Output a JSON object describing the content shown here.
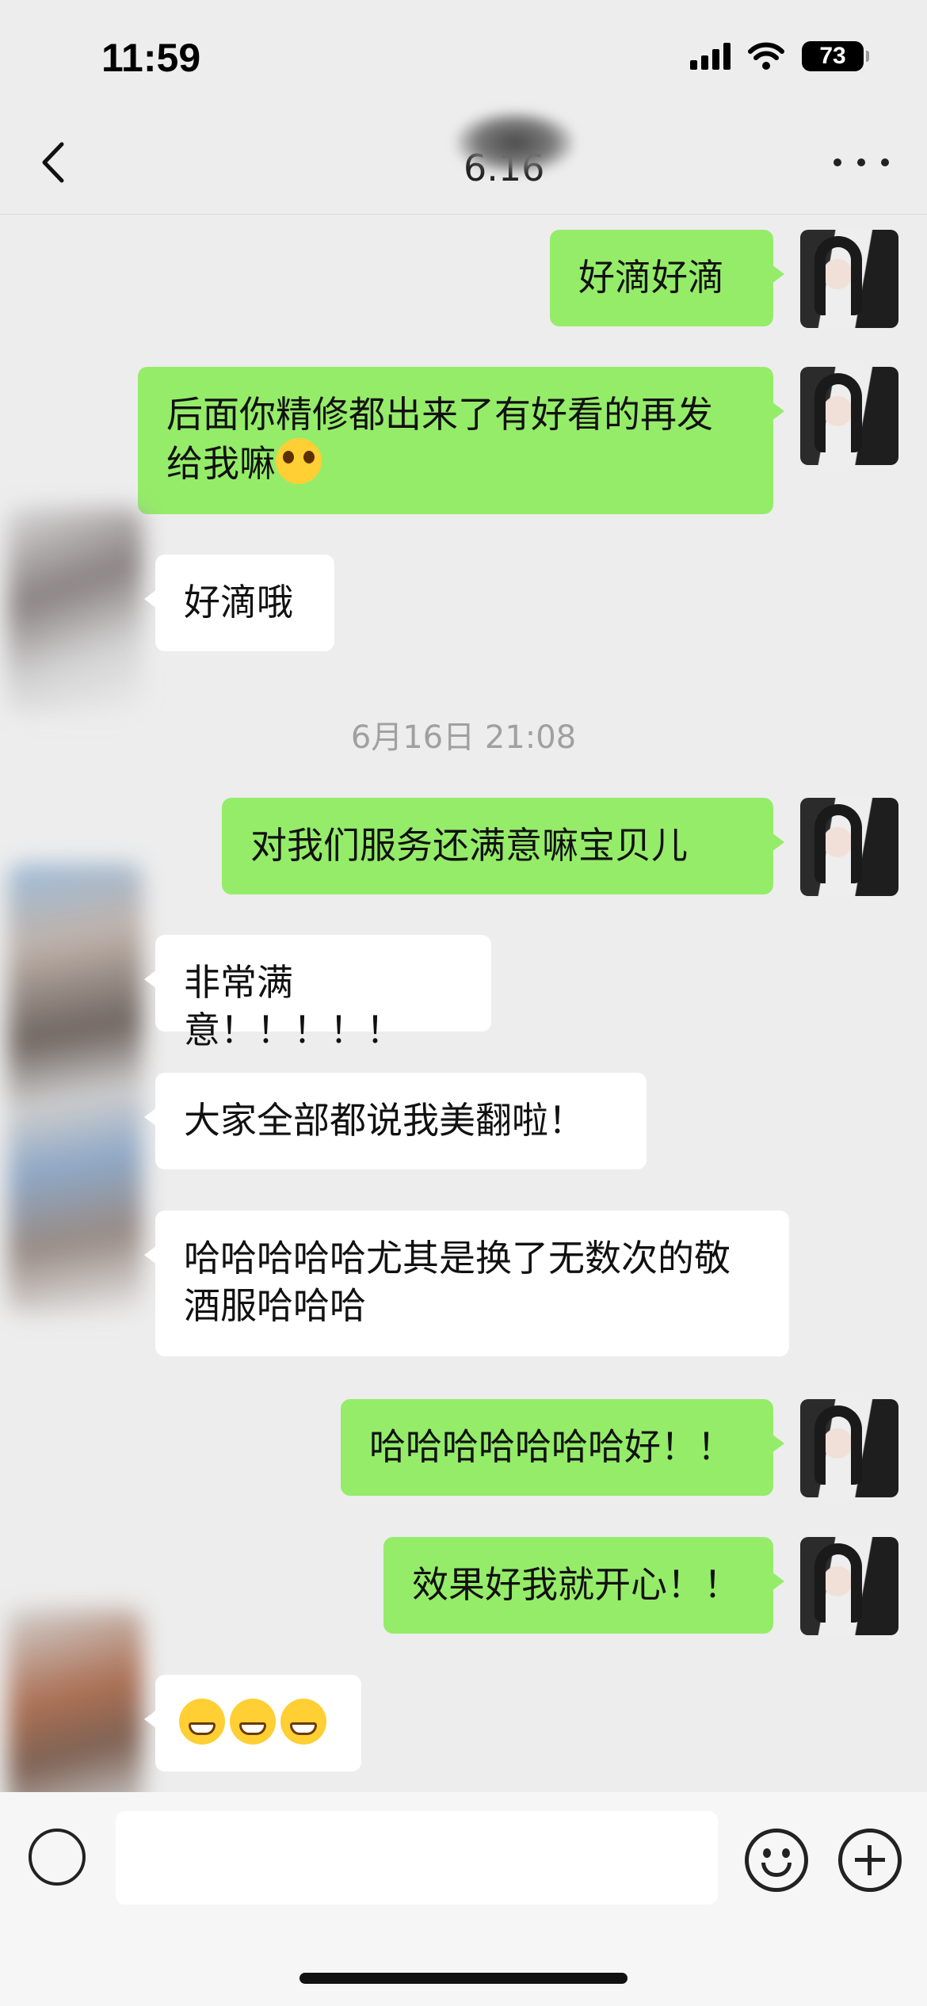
{
  "status_bar": {
    "time": "11:59",
    "battery": "73"
  },
  "header": {
    "title": "6.16"
  },
  "messages": [
    {
      "from": "me",
      "text": "好滴好滴"
    },
    {
      "from": "me",
      "text": "后面你精修都出来了有好看的再发给我嘛",
      "emoji": "pleading-face-emoji"
    },
    {
      "from": "other",
      "text": "好滴哦"
    },
    {
      "from": "system",
      "text": "6月16日 21:08"
    },
    {
      "from": "me",
      "text": "对我们服务还满意嘛宝贝儿"
    },
    {
      "from": "other",
      "text": "非常满意！！！！！"
    },
    {
      "from": "other",
      "text": "大家全部都说我美翻啦！"
    },
    {
      "from": "other",
      "text": "哈哈哈哈哈尤其是换了无数次的敬酒服哈哈哈"
    },
    {
      "from": "me",
      "text": "哈哈哈哈哈哈哈好！！"
    },
    {
      "from": "me",
      "text": "效果好我就开心！！"
    },
    {
      "from": "other",
      "text": "",
      "emoji": "grinning-face-emoji x3"
    }
  ],
  "input": {
    "value": "",
    "placeholder": ""
  },
  "colors": {
    "background": "#ededed",
    "my_bubble": "#95ec69",
    "other_bubble": "#ffffff"
  }
}
